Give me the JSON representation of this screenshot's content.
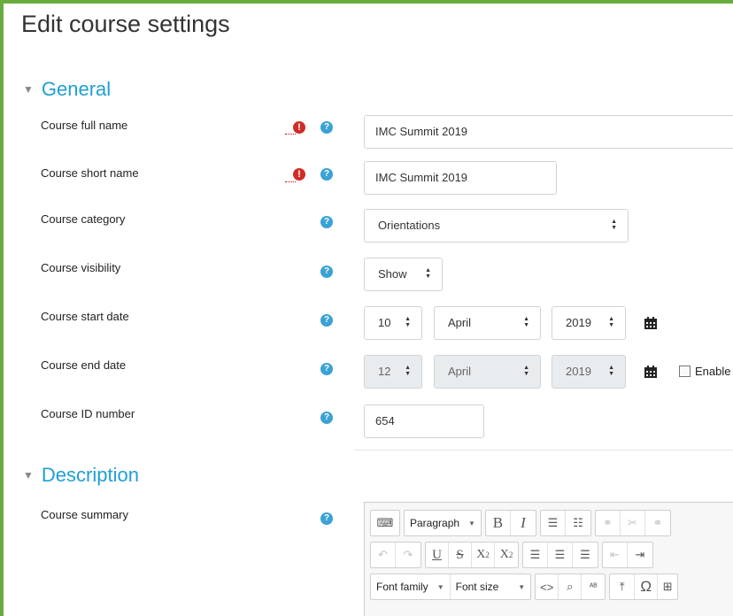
{
  "page_title": "Edit course settings",
  "sections": {
    "general": "General",
    "description": "Description"
  },
  "fields": {
    "full_name": {
      "label": "Course full name",
      "value": "IMC Summit 2019"
    },
    "short_name": {
      "label": "Course short name",
      "value": "IMC Summit 2019"
    },
    "category": {
      "label": "Course category",
      "value": "Orientations"
    },
    "visibility": {
      "label": "Course visibility",
      "value": "Show"
    },
    "start_date": {
      "label": "Course start date",
      "day": "10",
      "month": "April",
      "year": "2019"
    },
    "end_date": {
      "label": "Course end date",
      "day": "12",
      "month": "April",
      "year": "2019",
      "enable_label": "Enable"
    },
    "id_number": {
      "label": "Course ID number",
      "value": "654"
    },
    "summary": {
      "label": "Course summary"
    }
  },
  "editor": {
    "paragraph": "Paragraph",
    "font_family": "Font family",
    "font_size": "Font size",
    "bold": "B",
    "italic": "I",
    "underline": "U",
    "strike": "S",
    "subscript": "X",
    "sub_mark": "2",
    "superscript": "X",
    "sup_mark": "2"
  },
  "icons": {
    "required": "exclamation-circle-icon",
    "help": "question-circle-icon",
    "calendar": "calendar-icon",
    "select_arrows": "sort-arrows-icon"
  },
  "colors": {
    "frame": "#6aab3f",
    "section_heading": "#1f9fd5",
    "required": "#cf2d25",
    "help": "#3aa2d6"
  }
}
